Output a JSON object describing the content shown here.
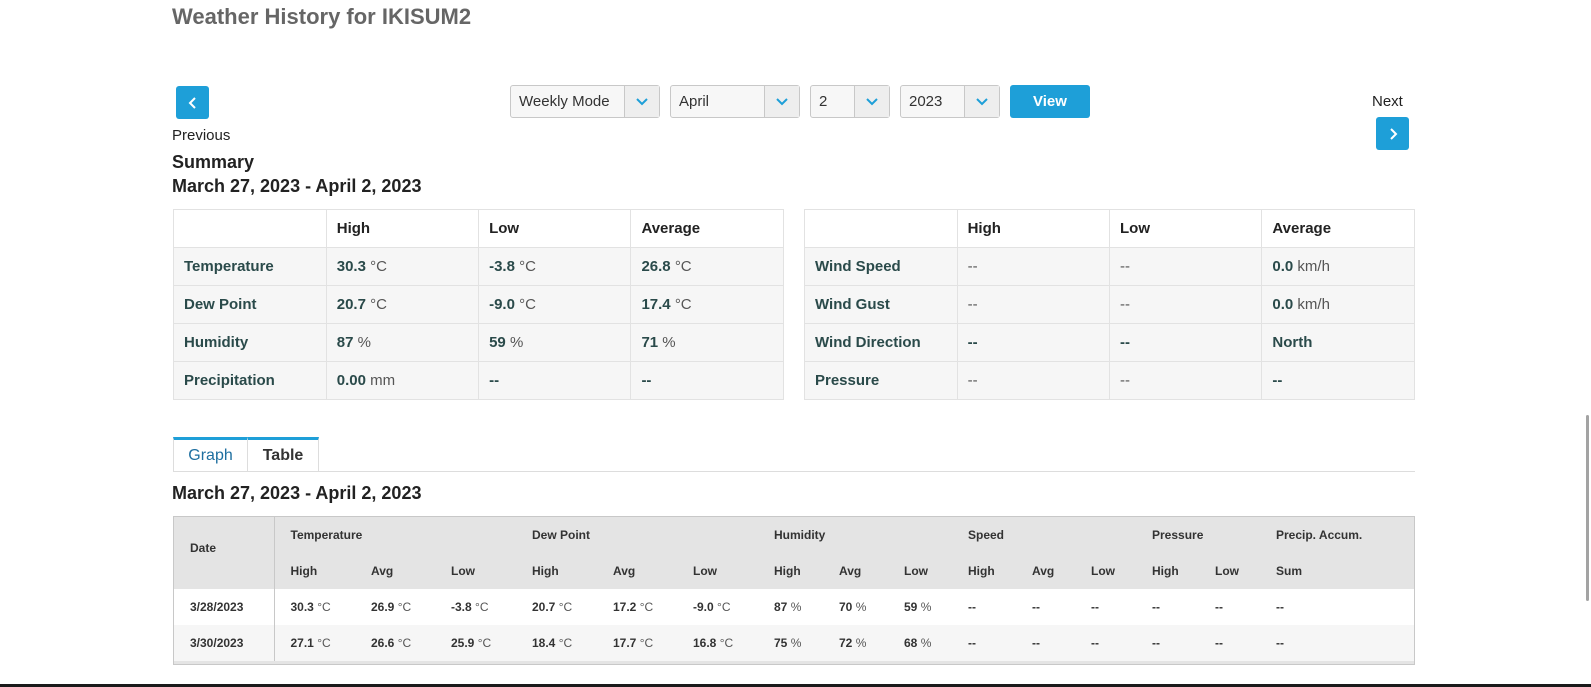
{
  "page": {
    "title": "Weather History for IKISUM2"
  },
  "nav": {
    "previous_label": "Previous",
    "next_label": "Next",
    "previous_icon": "chevron-left-icon",
    "next_icon": "chevron-right-icon"
  },
  "controls": {
    "mode": "Weekly Mode",
    "month": "April",
    "week": "2",
    "year": "2023",
    "view_label": "View"
  },
  "summary": {
    "title": "Summary",
    "range": "March 27, 2023 - April 2, 2023",
    "headers": [
      "",
      "High",
      "Low",
      "Average"
    ],
    "left_rows": [
      {
        "label": "Temperature",
        "high": {
          "v": "30.3",
          "u": "°C"
        },
        "low": {
          "v": "-3.8",
          "u": "°C"
        },
        "avg": {
          "v": "26.8",
          "u": "°C"
        }
      },
      {
        "label": "Dew Point",
        "high": {
          "v": "20.7",
          "u": "°C"
        },
        "low": {
          "v": "-9.0",
          "u": "°C"
        },
        "avg": {
          "v": "17.4",
          "u": "°C"
        }
      },
      {
        "label": "Humidity",
        "high": {
          "v": "87",
          "u": "%"
        },
        "low": {
          "v": "59",
          "u": "%"
        },
        "avg": {
          "v": "71",
          "u": "%"
        }
      },
      {
        "label": "Precipitation",
        "high": {
          "v": "0.00",
          "u": "mm"
        },
        "low": {
          "v": "--",
          "u": ""
        },
        "avg": {
          "v": "--",
          "u": ""
        }
      }
    ],
    "right_rows": [
      {
        "label": "Wind Speed",
        "high": {
          "v": "--",
          "u": "",
          "plain": true
        },
        "low": {
          "v": "--",
          "u": "",
          "plain": true
        },
        "avg": {
          "v": "0.0",
          "u": "km/h"
        }
      },
      {
        "label": "Wind Gust",
        "high": {
          "v": "--",
          "u": "",
          "plain": true
        },
        "low": {
          "v": "--",
          "u": "",
          "plain": true
        },
        "avg": {
          "v": "0.0",
          "u": "km/h"
        }
      },
      {
        "label": "Wind Direction",
        "high": {
          "v": "--",
          "u": ""
        },
        "low": {
          "v": "--",
          "u": ""
        },
        "avg": {
          "v": "North",
          "u": ""
        }
      },
      {
        "label": "Pressure",
        "high": {
          "v": "--",
          "u": "",
          "plain": true
        },
        "low": {
          "v": "--",
          "u": "",
          "plain": true
        },
        "avg": {
          "v": "--",
          "u": ""
        }
      }
    ]
  },
  "tabs": {
    "graph": "Graph",
    "table": "Table",
    "active": "table"
  },
  "history": {
    "range": "March 27, 2023 - April 2, 2023",
    "groups": [
      "Temperature",
      "Dew Point",
      "Humidity",
      "Speed",
      "Pressure",
      "Precip. Accum."
    ],
    "subheaders": [
      "Date",
      "High",
      "Avg",
      "Low",
      "High",
      "Avg",
      "Low",
      "High",
      "Avg",
      "Low",
      "High",
      "Avg",
      "Low",
      "High",
      "Low",
      "Sum"
    ],
    "rows": [
      {
        "date": "3/28/2023",
        "cells": [
          {
            "v": "30.3",
            "u": "°C"
          },
          {
            "v": "26.9",
            "u": "°C"
          },
          {
            "v": "-3.8",
            "u": "°C"
          },
          {
            "v": "20.7",
            "u": "°C"
          },
          {
            "v": "17.2",
            "u": "°C"
          },
          {
            "v": "-9.0",
            "u": "°C"
          },
          {
            "v": "87",
            "u": "%"
          },
          {
            "v": "70",
            "u": "%"
          },
          {
            "v": "59",
            "u": "%"
          },
          {
            "v": "--",
            "u": ""
          },
          {
            "v": "--",
            "u": ""
          },
          {
            "v": "--",
            "u": ""
          },
          {
            "v": "--",
            "u": ""
          },
          {
            "v": "--",
            "u": ""
          },
          {
            "v": "--",
            "u": ""
          }
        ]
      },
      {
        "date": "3/30/2023",
        "cells": [
          {
            "v": "27.1",
            "u": "°C"
          },
          {
            "v": "26.6",
            "u": "°C"
          },
          {
            "v": "25.9",
            "u": "°C"
          },
          {
            "v": "18.4",
            "u": "°C"
          },
          {
            "v": "17.7",
            "u": "°C"
          },
          {
            "v": "16.8",
            "u": "°C"
          },
          {
            "v": "75",
            "u": "%"
          },
          {
            "v": "72",
            "u": "%"
          },
          {
            "v": "68",
            "u": "%"
          },
          {
            "v": "--",
            "u": ""
          },
          {
            "v": "--",
            "u": ""
          },
          {
            "v": "--",
            "u": ""
          },
          {
            "v": "--",
            "u": ""
          },
          {
            "v": "--",
            "u": ""
          },
          {
            "v": "--",
            "u": ""
          }
        ]
      }
    ]
  },
  "colors": {
    "accent": "#1e9fd8",
    "title_gray": "#666666"
  }
}
